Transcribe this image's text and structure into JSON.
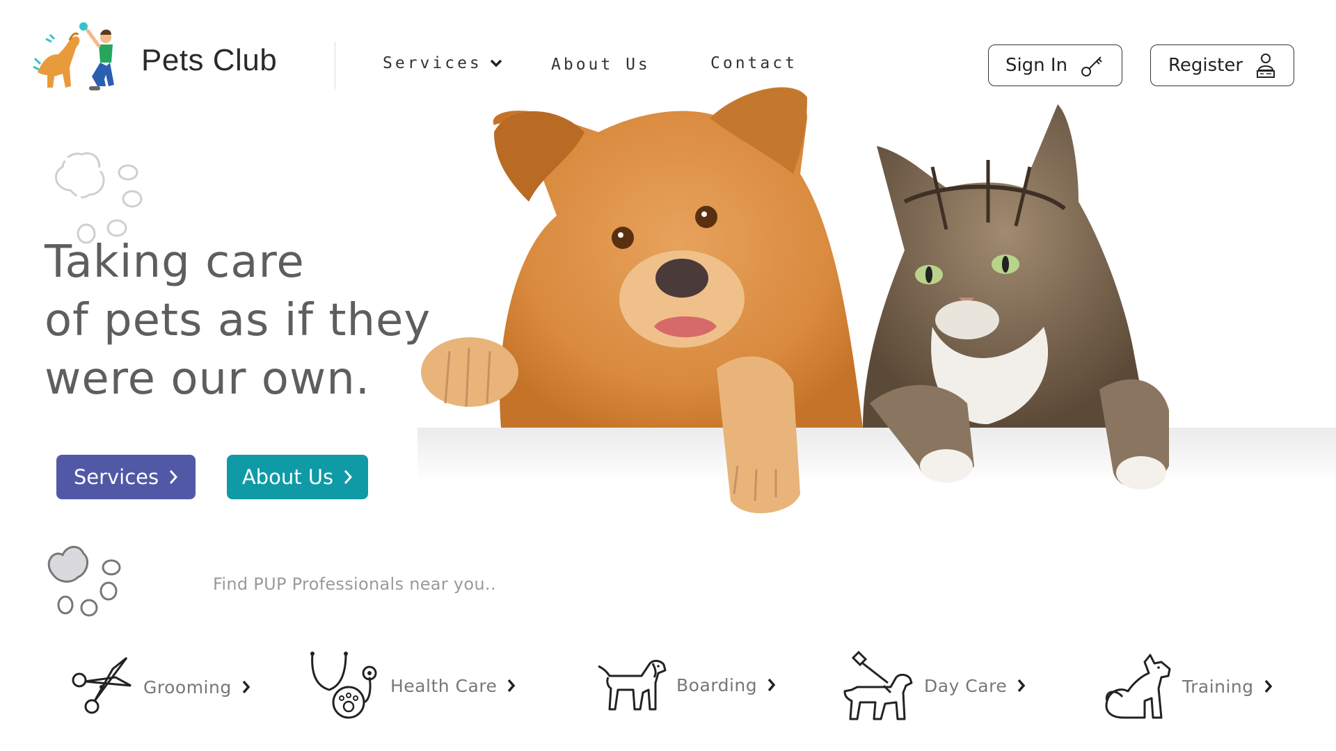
{
  "brand": {
    "name": "Pets Club",
    "logo_icon": "kid-playing-with-dog-logo"
  },
  "nav": {
    "services": "Services",
    "about": "About Us",
    "contact": "Contact"
  },
  "auth": {
    "sign_in": "Sign In",
    "sign_in_icon": "key-icon",
    "register": "Register",
    "register_icon": "user-register-icon"
  },
  "hero": {
    "headline": [
      "Taking care",
      "of pets as if they",
      "were our own."
    ],
    "buttons": {
      "services": "Services",
      "about": "About Us"
    },
    "find_text": "Find PUP Professionals near you.."
  },
  "services": [
    {
      "label": "Grooming",
      "icon": "scissors-icon"
    },
    {
      "label": "Health Care",
      "icon": "stethoscope-icon"
    },
    {
      "label": "Boarding",
      "icon": "dog-icon"
    },
    {
      "label": "Day Care",
      "icon": "dog-walking-icon"
    },
    {
      "label": "Training",
      "icon": "sitting-dog-icon"
    }
  ],
  "colors": {
    "services_button": "#5158a6",
    "about_button": "#0f9aa6",
    "headline": "#5e5e5e"
  }
}
